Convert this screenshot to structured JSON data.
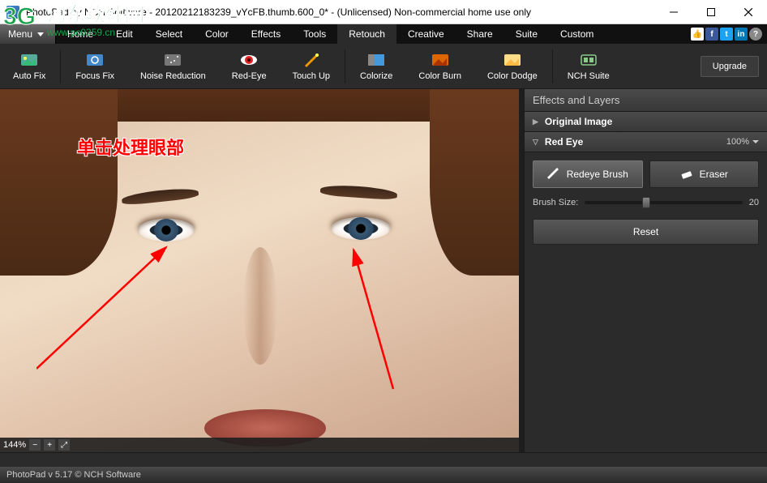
{
  "window": {
    "title": "PhotoPad by NCH Software - 20120212183239_vYcFB.thumb.600_0* - (Unlicensed) Non-commercial home use only"
  },
  "menu": {
    "dropdown_label": "Menu",
    "tabs": [
      "Home",
      "Edit",
      "Select",
      "Color",
      "Effects",
      "Tools",
      "Retouch",
      "Creative",
      "Share",
      "Suite",
      "Custom"
    ],
    "active_tab": "Retouch"
  },
  "toolbar": {
    "items": [
      {
        "label": "Auto Fix",
        "icon": "autofix-icon"
      },
      {
        "label": "Focus Fix",
        "icon": "focusfix-icon"
      },
      {
        "label": "Noise Reduction",
        "icon": "noise-icon"
      },
      {
        "label": "Red-Eye",
        "icon": "redeye-icon"
      },
      {
        "label": "Touch Up",
        "icon": "touchup-icon"
      },
      {
        "label": "Colorize",
        "icon": "colorize-icon"
      },
      {
        "label": "Color Burn",
        "icon": "colorburn-icon"
      },
      {
        "label": "Color Dodge",
        "icon": "colordodge-icon"
      },
      {
        "label": "NCH Suite",
        "icon": "nchsuite-icon"
      }
    ],
    "upgrade_label": "Upgrade"
  },
  "canvas": {
    "annotation_text": "单击处理眼部",
    "zoom": {
      "value": "144%"
    }
  },
  "panel": {
    "title": "Effects and Layers",
    "sections": {
      "original": {
        "label": "Original Image",
        "expanded": false
      },
      "redeye": {
        "label": "Red Eye",
        "opacity": "100%",
        "expanded": true,
        "brush_buttons": [
          {
            "label": "Redeye Brush",
            "active": true
          },
          {
            "label": "Eraser",
            "active": false
          }
        ],
        "slider": {
          "label": "Brush Size:",
          "value": 20,
          "min": 1,
          "max": 50
        },
        "reset_label": "Reset"
      }
    }
  },
  "status": {
    "text": "PhotoPad v 5.17  © NCH Software"
  },
  "watermark": {
    "line1": "3G",
    "line2": "www.pc0359.cn",
    "chinese": "河东软件园"
  }
}
